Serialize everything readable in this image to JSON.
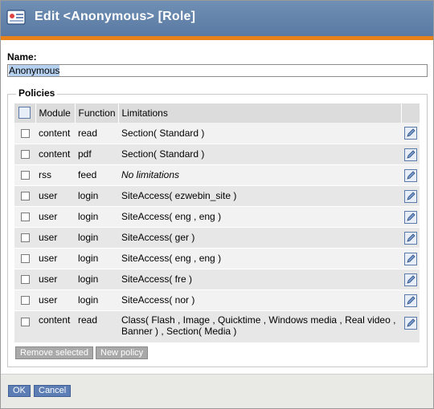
{
  "header": {
    "title": "Edit <Anonymous> [Role]",
    "icon": "role-card-icon"
  },
  "name_field": {
    "label": "Name:",
    "value": "Anonymous"
  },
  "policies": {
    "legend": "Policies",
    "columns": {
      "module": "Module",
      "function": "Function",
      "limitations": "Limitations"
    },
    "rows": [
      {
        "module": "content",
        "function": "read",
        "limitations": "Section( Standard )"
      },
      {
        "module": "content",
        "function": "pdf",
        "limitations": "Section( Standard )"
      },
      {
        "module": "rss",
        "function": "feed",
        "limitations": "No limitations"
      },
      {
        "module": "user",
        "function": "login",
        "limitations": "SiteAccess( ezwebin_site )"
      },
      {
        "module": "user",
        "function": "login",
        "limitations": "SiteAccess( eng , eng )"
      },
      {
        "module": "user",
        "function": "login",
        "limitations": "SiteAccess( ger )"
      },
      {
        "module": "user",
        "function": "login",
        "limitations": "SiteAccess( eng , eng )"
      },
      {
        "module": "user",
        "function": "login",
        "limitations": "SiteAccess( fre )"
      },
      {
        "module": "user",
        "function": "login",
        "limitations": "SiteAccess( nor )"
      },
      {
        "module": "content",
        "function": "read",
        "limitations": "Class( Flash , Image , Quicktime , Windows media , Real video , Banner ) , Section( Media )"
      }
    ],
    "remove_button": "Remove selected",
    "new_button": "New policy"
  },
  "footer": {
    "ok": "OK",
    "cancel": "Cancel"
  },
  "colors": {
    "titlebar": "#6384ad",
    "accent": "#e7821a",
    "button_blue": "#5c7eb4",
    "button_gray": "#a9a9a9"
  }
}
